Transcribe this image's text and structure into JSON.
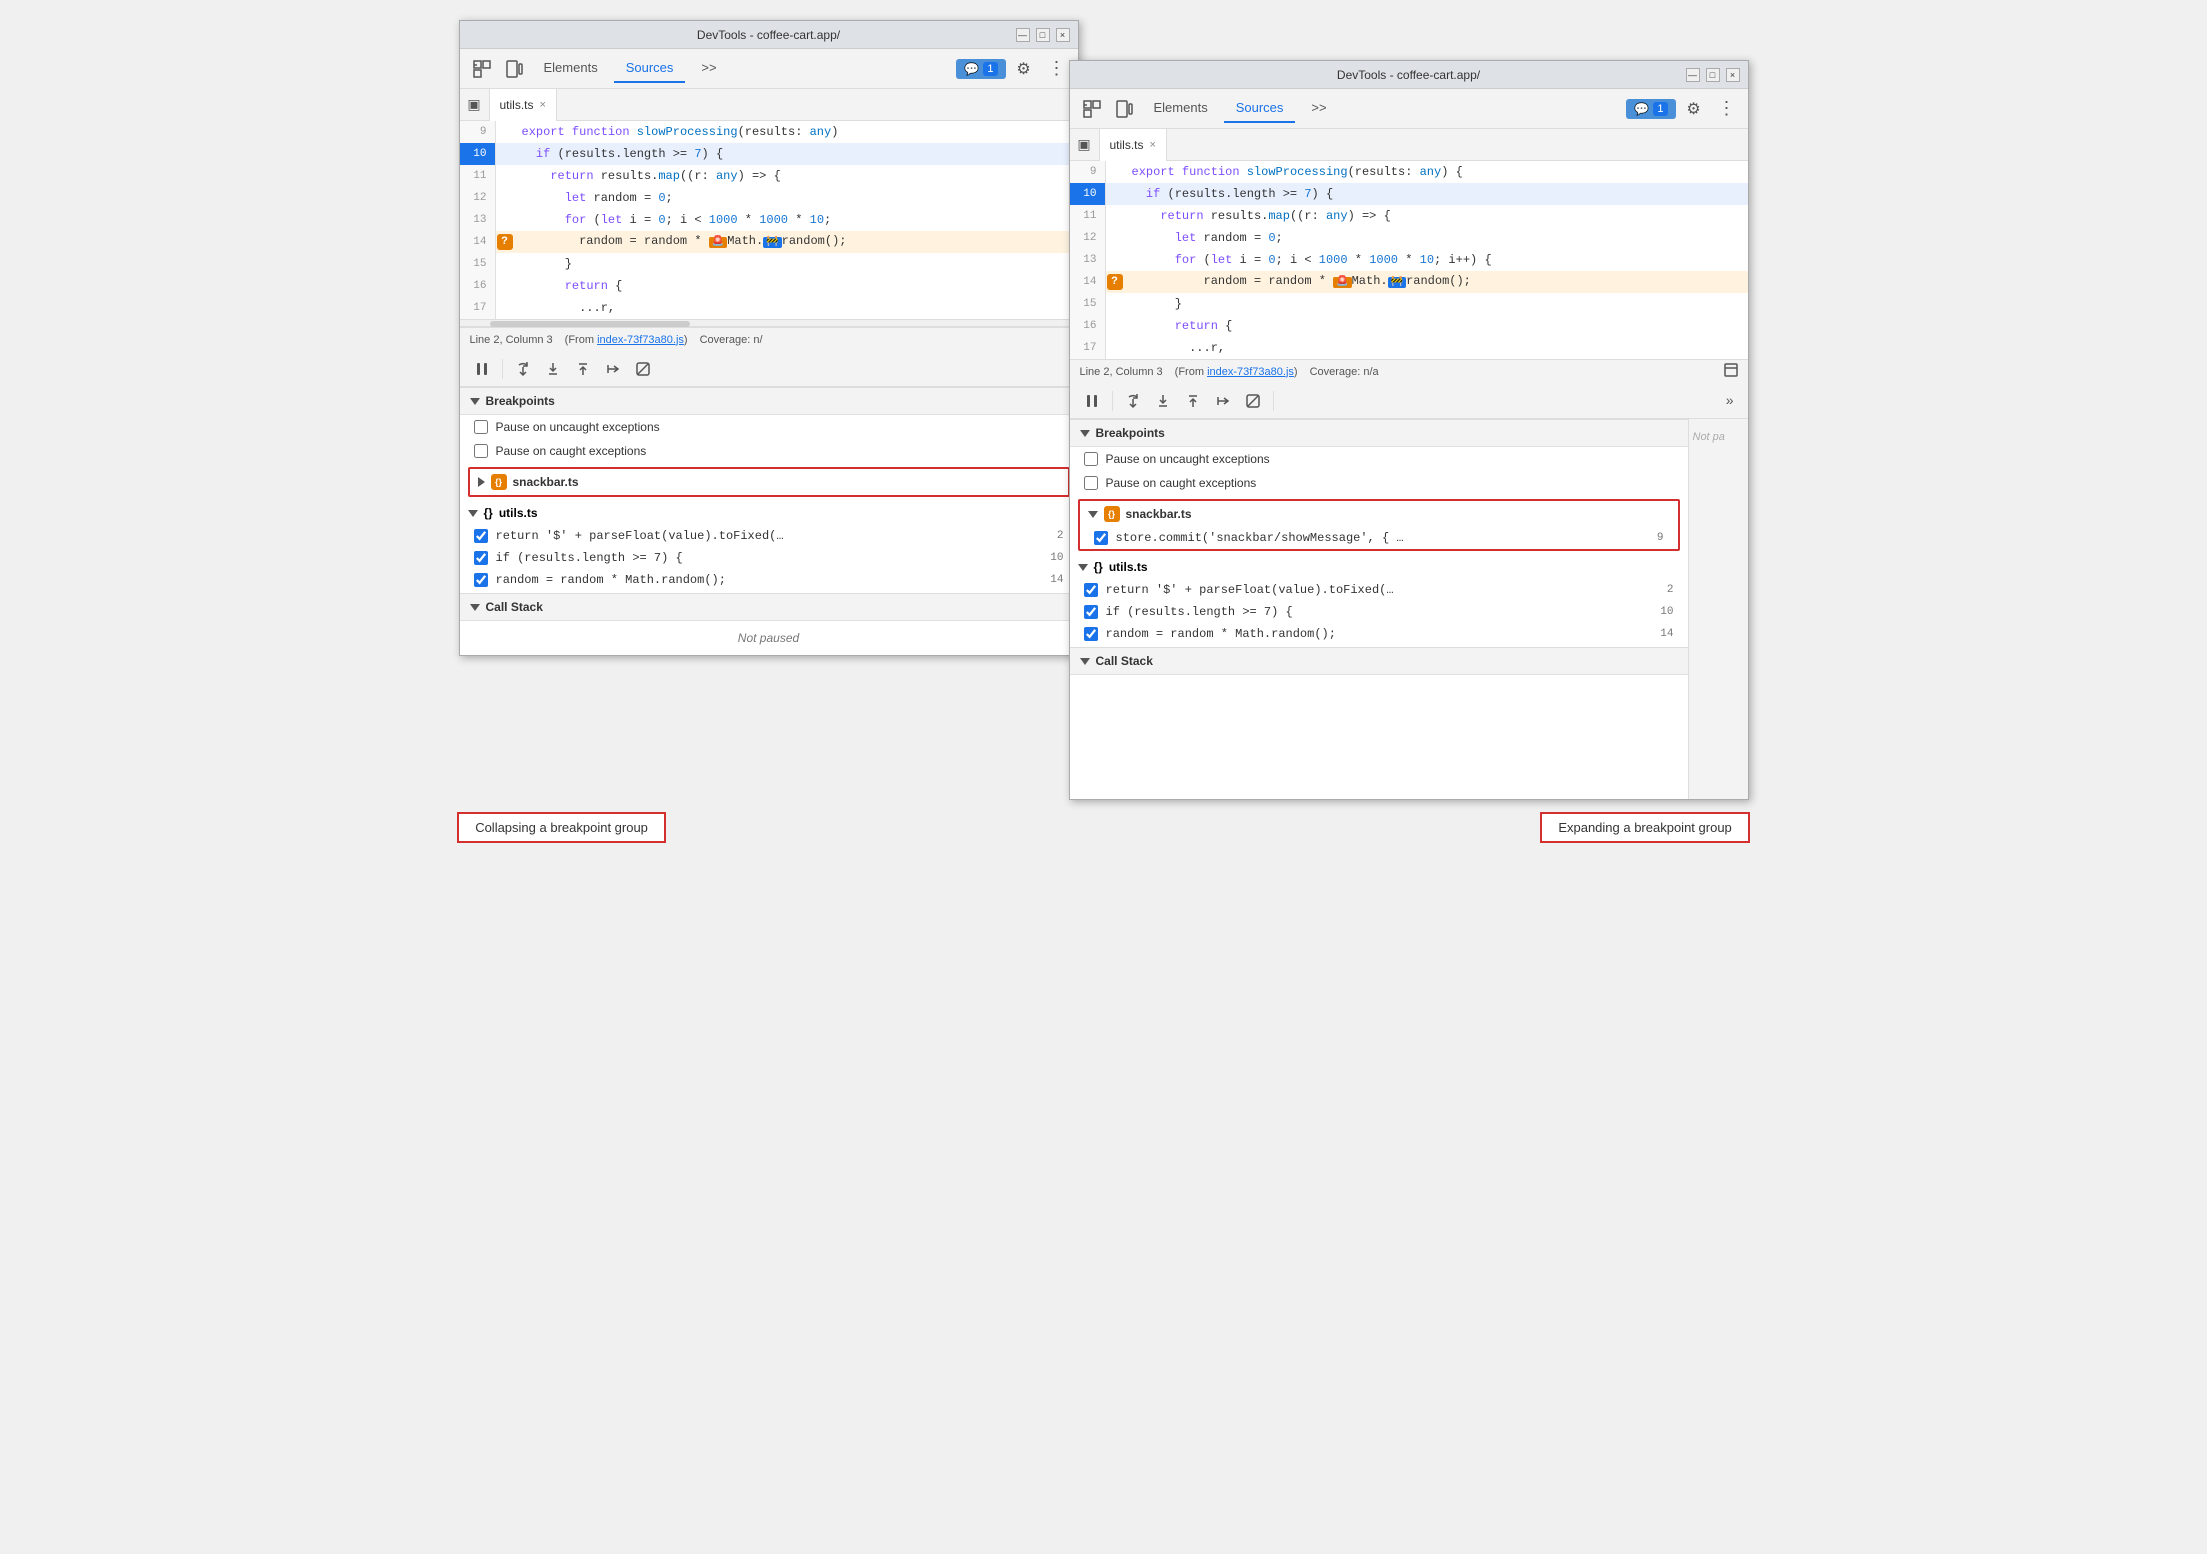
{
  "left_window": {
    "title": "DevTools - coffee-cart.app/",
    "tabs": [
      "Elements",
      "Sources",
      ">>"
    ],
    "active_tab": "Sources",
    "file_tab": "utils.ts",
    "code_lines": [
      {
        "num": 9,
        "content": "export function slowProcessing(results: any)",
        "type": "normal"
      },
      {
        "num": 10,
        "content": "  if (results.length >= 7) {",
        "type": "active"
      },
      {
        "num": 11,
        "content": "    return results.map((r: any) => {",
        "type": "normal"
      },
      {
        "num": 12,
        "content": "      let random = 0;",
        "type": "normal"
      },
      {
        "num": 13,
        "content": "      for (let i = 0; i < 1000 * 1000 * 10;",
        "type": "normal"
      },
      {
        "num": 14,
        "content": "          random = random * 🚨Math.🚧random();",
        "type": "breakpoint"
      },
      {
        "num": 15,
        "content": "      }",
        "type": "normal"
      },
      {
        "num": 16,
        "content": "      return {",
        "type": "normal"
      },
      {
        "num": 17,
        "content": "        ...r,",
        "type": "normal"
      }
    ],
    "status_line": "Line 2, Column 3",
    "status_from": "(From index-73f73a80.js)",
    "status_coverage": "Coverage: n/",
    "debug_buttons": [
      "pause",
      "step-over",
      "step-into",
      "step-out",
      "step",
      "deactivate"
    ],
    "breakpoints_label": "Breakpoints",
    "pause_uncaught": "Pause on uncaught exceptions",
    "pause_caught": "Pause on caught exceptions",
    "snackbar_group": {
      "name": "snackbar.ts",
      "expanded": false,
      "items": []
    },
    "utils_group": {
      "name": "utils.ts",
      "expanded": true,
      "items": [
        {
          "text": "return '$' + parseFloat(value).toFixed(…",
          "line": 2
        },
        {
          "text": "if (results.length >= 7) {",
          "line": 10
        },
        {
          "text": "random = random * Math.random();",
          "line": 14
        }
      ]
    },
    "call_stack_label": "Call Stack",
    "not_paused": "Not paused"
  },
  "right_window": {
    "title": "DevTools - coffee-cart.app/",
    "tabs": [
      "Elements",
      "Sources",
      ">>"
    ],
    "active_tab": "Sources",
    "file_tab": "utils.ts",
    "code_lines": [
      {
        "num": 9,
        "content": "export function slowProcessing(results: any) {",
        "type": "normal"
      },
      {
        "num": 10,
        "content": "  if (results.length >= 7) {",
        "type": "active"
      },
      {
        "num": 11,
        "content": "    return results.map((r: any) => {",
        "type": "normal"
      },
      {
        "num": 12,
        "content": "      let random = 0;",
        "type": "normal"
      },
      {
        "num": 13,
        "content": "      for (let i = 0; i < 1000 * 1000 * 10; i++) {",
        "type": "normal"
      },
      {
        "num": 14,
        "content": "          random = random * 🚨Math.🚧random();",
        "type": "breakpoint"
      },
      {
        "num": 15,
        "content": "      }",
        "type": "normal"
      },
      {
        "num": 16,
        "content": "      return {",
        "type": "normal"
      },
      {
        "num": 17,
        "content": "        ...r,",
        "type": "normal"
      }
    ],
    "status_line": "Line 2, Column 3",
    "status_from": "(From index-73f73a80.js)",
    "status_coverage": "Coverage: n/a",
    "debug_buttons": [
      "pause",
      "step-over",
      "step-into",
      "step-out",
      "step",
      "deactivate"
    ],
    "breakpoints_label": "Breakpoints",
    "pause_uncaught": "Pause on uncaught exceptions",
    "pause_caught": "Pause on caught exceptions",
    "snackbar_group": {
      "name": "snackbar.ts",
      "expanded": true,
      "items": [
        {
          "text": "store.commit('snackbar/showMessage', { …",
          "line": 9
        }
      ]
    },
    "utils_group": {
      "name": "utils.ts",
      "expanded": true,
      "items": [
        {
          "text": "return '$' + parseFloat(value).toFixed(…",
          "line": 2
        },
        {
          "text": "if (results.length >= 7) {",
          "line": 10
        },
        {
          "text": "random = random * Math.random();",
          "line": 14
        }
      ]
    },
    "call_stack_label": "Call Stack",
    "not_paused_label": "Not pa",
    "overflow_label": ">>"
  },
  "labels": {
    "left": "Collapsing a breakpoint group",
    "right": "Expanding a breakpoint group"
  },
  "icons": {
    "inspect": "⬚",
    "device": "⬜",
    "more_tabs": "»",
    "more_options": "⋮",
    "chat": "💬",
    "gear": "⚙",
    "sidebar": "▣",
    "close": "×",
    "pause": "⏸",
    "step_over": "↻",
    "step_into": "↓",
    "step_out": "↑",
    "step": "→",
    "deactivate": "⊘",
    "chevron_down": "▼",
    "chevron_right": "▶",
    "file_ts": "{}"
  }
}
